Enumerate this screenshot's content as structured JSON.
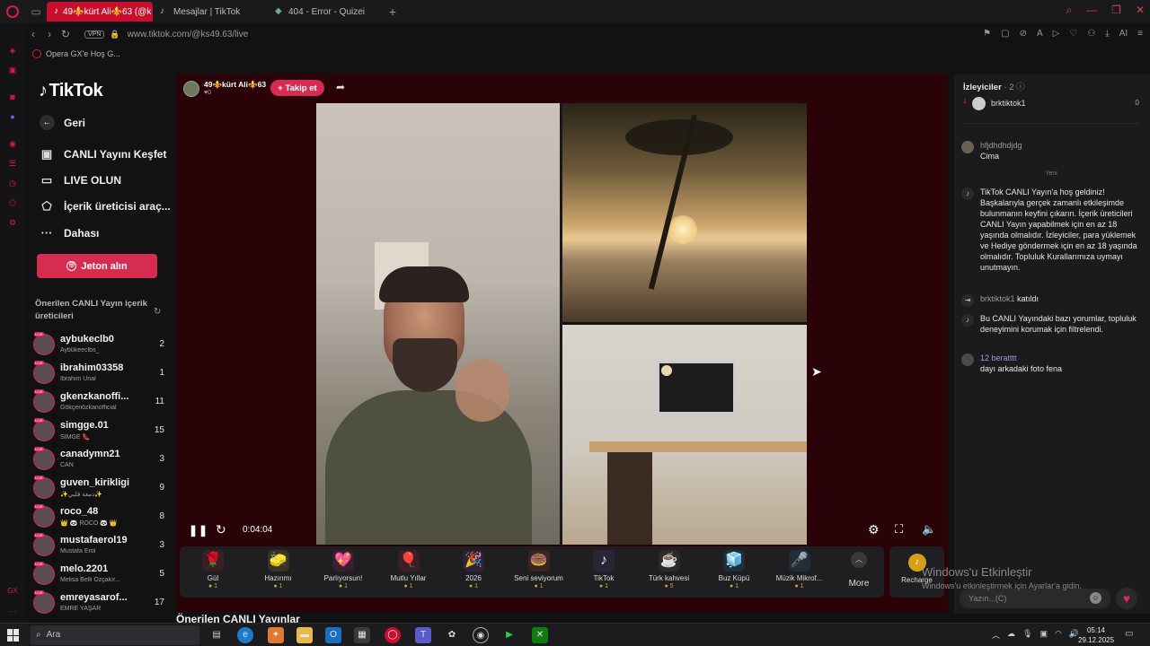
{
  "browser": {
    "tabs": [
      {
        "label": "49⚜️kürt Ali⚜️63 (@k",
        "active": true
      },
      {
        "label": "Mesajlar | TikTok",
        "active": false
      },
      {
        "label": "404 - Error - Quizei",
        "active": false
      }
    ],
    "url": "www.tiktok.com/@ks49.63/live",
    "vpn_label": "VPN",
    "bookmark": "Opera GX'e Hoş G..."
  },
  "sidebar": {
    "logo": "TikTok",
    "nav": [
      {
        "label": "Geri",
        "icon": "back-arrow-icon"
      },
      {
        "label": "CANLI Yayını Keşfet",
        "icon": "live-tv-icon"
      },
      {
        "label": "LIVE OLUN",
        "icon": "camera-icon"
      },
      {
        "label": "İçerik üreticisi araç...",
        "icon": "creator-tools-icon"
      },
      {
        "label": "Dahası",
        "icon": "more-dots-icon"
      }
    ],
    "coin_button": "Jeton alın",
    "suggested_title": "Önerilen CANLI Yayın içerik üreticileri",
    "creators": [
      {
        "name": "aybukeclb0",
        "sub": "Aybükeeclbs_",
        "count": "2"
      },
      {
        "name": "ibrahim03358",
        "sub": "İbrahim Ünal",
        "count": "1"
      },
      {
        "name": "gkenzkanoffi...",
        "sub": "Gökçenözkanofficial",
        "count": "11"
      },
      {
        "name": "simgge.01",
        "sub": "SİMGE 👠",
        "count": "15"
      },
      {
        "name": "canadymn21",
        "sub": "CAN",
        "count": "3"
      },
      {
        "name": "guven_kirikligi",
        "sub": "✨دمعة قلبي✨",
        "count": "9"
      },
      {
        "name": "roco_48",
        "sub": "👑 🐼 ROCO 🐼 👑",
        "count": "8"
      },
      {
        "name": "mustafaerol19",
        "sub": "Mustafa Erol",
        "count": "3"
      },
      {
        "name": "melo.2201",
        "sub": "Melisa Belli Özçakır...",
        "count": "5"
      },
      {
        "name": "emreyasarof...",
        "sub": "EMRE YAŞAR",
        "count": "17"
      }
    ]
  },
  "stream": {
    "host_name": "49⚜️kürt Ali⚜️63",
    "host_likes": "♥0",
    "follow_label": "+ Takip et",
    "timecode": "0:04:04",
    "more_label": "More",
    "recharge_label": "Recharge",
    "gifts": [
      {
        "name": "Gül",
        "price": "1",
        "icon": "🌹",
        "bg": "#3a1f26"
      },
      {
        "name": "Hazırımı",
        "price": "1",
        "icon": "🧽",
        "bg": "#3a3520"
      },
      {
        "name": "Parlıyorsun!",
        "price": "1",
        "icon": "💖",
        "bg": "#3a1f2e"
      },
      {
        "name": "Mutlu Yıllar",
        "price": "1",
        "icon": "🎈",
        "bg": "#3a1f26"
      },
      {
        "name": "2026",
        "price": "1",
        "icon": "🎉",
        "bg": "#2a2438"
      },
      {
        "name": "Seni seviyorum",
        "price": "1",
        "icon": "🍩",
        "bg": "#3a2620"
      },
      {
        "name": "TikTok",
        "price": "1",
        "icon": "♪",
        "bg": "#2a2438"
      },
      {
        "name": "Türk kahvesi",
        "price": "5",
        "icon": "☕",
        "bg": "#2e2a26"
      },
      {
        "name": "Buz Küpü",
        "price": "1",
        "icon": "🧊",
        "bg": "#1f2e3a"
      },
      {
        "name": "Müzik Mikrof...",
        "price": "1",
        "icon": "🎤",
        "bg": "#1f2e3a"
      }
    ],
    "suggested_live": "Önerilen CANLI Yayınlar"
  },
  "chat": {
    "viewers_title": "İzleyiciler",
    "viewers_count": "· 2",
    "viewer": {
      "rank": "1",
      "name": "brktiktok1",
      "score": "0"
    },
    "messages": [
      {
        "user": "hfjdhdhdjdg",
        "text": "Cima"
      },
      {
        "user": "",
        "text": "TikTok CANLI Yayın'a hoş geldiniz! Başkalarıyla gerçek zamanlı etkileşimde bulunmanın keyfini çıkarın. İçerik üreticileri CANLI Yayın yapabilmek için en az 18 yaşında olmalıdır. İzleyiciler, para yüklemek ve Hediye göndermek için en az 18 yaşında olmalıdır. Topluluk Kurallarımıza uymayı unutmayın."
      },
      {
        "user": "brktiktok1",
        "text": "katıldı"
      },
      {
        "user": "",
        "text": "Bu CANLI Yayındaki bazı yorumlar, topluluk deneyimini korumak için filtrelendi."
      },
      {
        "user": "12  beratttt",
        "text": "dayı arkadaki foto fena"
      }
    ],
    "new_label": "Yeni",
    "input_placeholder": "Yazın...(C)"
  },
  "windows_notice": {
    "title": "Windows'u Etkinleştir",
    "sub": "Windows'u etkinleştirmek için Ayarlar'a gidin."
  },
  "taskbar": {
    "search_label": "Ara",
    "time": "05:14",
    "date": "29.12.2025"
  },
  "colors": {
    "accent": "#d62c52",
    "opera_red": "#e01a3e",
    "stream_bg": "#2a0308"
  }
}
